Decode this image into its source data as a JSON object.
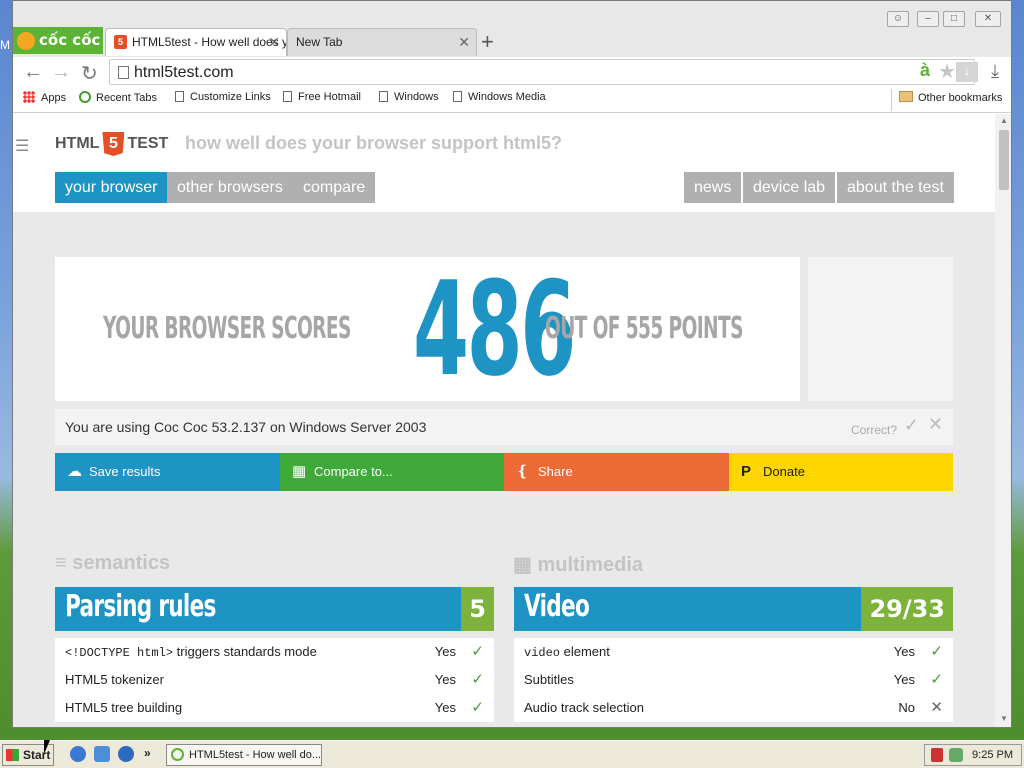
{
  "tabs": [
    {
      "label": "HTML5test - How well does y",
      "active": true
    },
    {
      "label": "New Tab",
      "active": false
    }
  ],
  "logo": "cốc cốc",
  "url": "html5test.com",
  "bookmarks": [
    "Apps",
    "Recent Tabs",
    "Customize Links",
    "Free Hotmail",
    "Windows",
    "Windows Media"
  ],
  "other_bookmarks": "Other bookmarks",
  "site": {
    "logo_left": "HTML",
    "logo_mid": "5",
    "logo_right": "TEST",
    "tagline": "how well does your browser support html5?",
    "nav_left": [
      "your browser",
      "other browsers",
      "compare"
    ],
    "nav_right": [
      "news",
      "device lab",
      "about the test"
    ],
    "score_prefix": "YOUR BROWSER SCORES",
    "score": "486",
    "score_suffix": "OUT OF 555 POINTS",
    "ua_text": "You are using Coc Coc 53.2.137 on Windows Server 2003",
    "correct": "Correct?",
    "actions": [
      {
        "label": "Save results",
        "color": "#1e94c5",
        "icon": "cloud-upload-icon"
      },
      {
        "label": "Compare to...",
        "color": "#3faa3a",
        "icon": "grid-icon"
      },
      {
        "label": "Share",
        "color": "#eb6a36",
        "icon": "share-icon"
      },
      {
        "label": "Donate",
        "color": "#ffd500",
        "icon": "paypal-icon"
      }
    ],
    "sections": [
      {
        "name": "semantics",
        "category": "Parsing rules",
        "score": "5",
        "rows": [
          {
            "code": "<!DOCTYPE html>",
            "text": " triggers standards mode",
            "value": "Yes",
            "ok": true
          },
          {
            "code": "",
            "text": "HTML5 tokenizer",
            "value": "Yes",
            "ok": true
          },
          {
            "code": "",
            "text": "HTML5 tree building",
            "value": "Yes",
            "ok": true
          }
        ]
      },
      {
        "name": "multimedia",
        "category": "Video",
        "score": "29/33",
        "rows": [
          {
            "code": "video",
            "text": " element",
            "value": "Yes",
            "ok": true
          },
          {
            "code": "",
            "text": "Subtitles",
            "value": "Yes",
            "ok": true
          },
          {
            "code": "",
            "text": "Audio track selection",
            "value": "No",
            "ok": false
          }
        ]
      }
    ]
  },
  "taskbar": {
    "start": "Start",
    "task": "HTML5test - How well do...",
    "time": "9:25 PM"
  },
  "colors": {
    "accent": "#1e94c5",
    "green": "#7db33a",
    "grey_tab": "#b0b0b0"
  }
}
